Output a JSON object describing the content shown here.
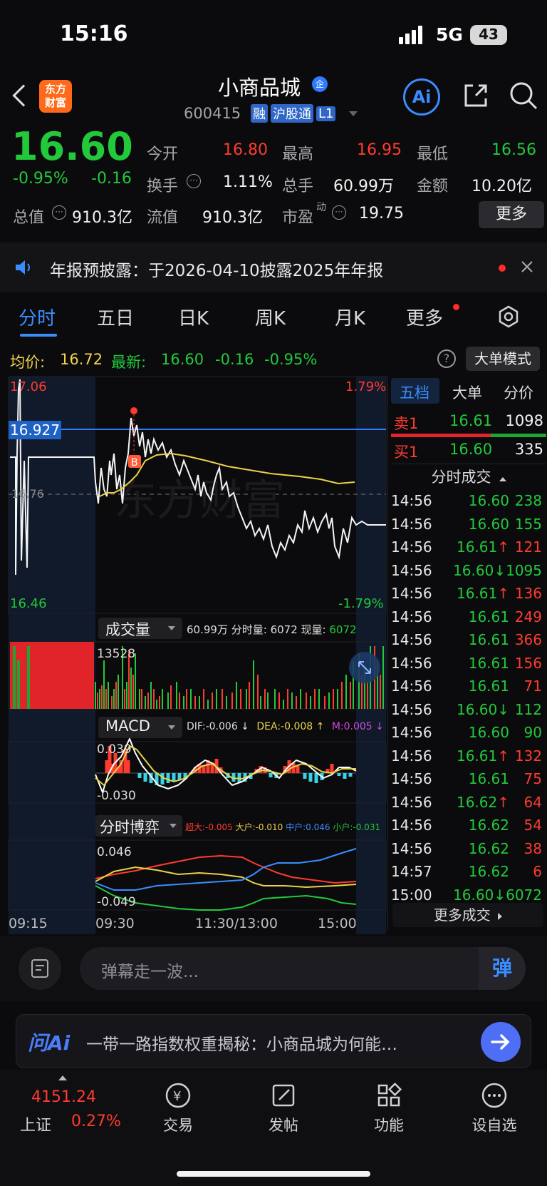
{
  "status_bar": {
    "time": "15:16",
    "network": "5G",
    "battery": "43"
  },
  "header": {
    "brand_line1": "东方",
    "brand_line2": "财富",
    "stock_name": "小商品城",
    "name_badge": "企",
    "code": "600415",
    "tags": [
      "融",
      "沪股通",
      "L1"
    ],
    "ai_label": "Ai"
  },
  "quote": {
    "price": "16.60",
    "change_pct": "-0.95%",
    "change": "-0.16",
    "fields": [
      {
        "label": "今开",
        "value": "16.80",
        "color": "#ff3b30"
      },
      {
        "label": "最高",
        "value": "16.95",
        "color": "#ff3b30"
      },
      {
        "label": "最低",
        "value": "16.56",
        "color": "#22c93a"
      },
      {
        "label": "换手",
        "value": "1.11%",
        "color": "#f2f2f2"
      },
      {
        "label": "总手",
        "value": "60.99万",
        "color": "#f2f2f2"
      },
      {
        "label": "金额",
        "value": "10.20亿",
        "color": "#f2f2f2"
      },
      {
        "label": "总值",
        "value": "910.3亿",
        "color": "#f2f2f2"
      },
      {
        "label": "流值",
        "value": "910.3亿",
        "color": "#f2f2f2"
      },
      {
        "label": "市盈",
        "value": "19.75",
        "color": "#f2f2f2"
      }
    ],
    "pe_sup": "动",
    "more_button": "更多"
  },
  "notice": {
    "text": "年报预披露：于2026-04-10披露2025年年报"
  },
  "tabs": [
    "分时",
    "五日",
    "日K",
    "周K",
    "月K",
    "更多"
  ],
  "avg_line": {
    "avg_label": "均价:",
    "avg_value": "16.72",
    "latest_label": "最新:",
    "latest_value": "16.60",
    "latest_change": "-0.16",
    "latest_pct": "-0.95%",
    "big_order_button": "大单模式"
  },
  "chart_labels": {
    "high_price": "17.06",
    "high_pct": "1.79%",
    "low_price": "16.46",
    "low_pct": "-1.79%",
    "crosshair_price": "16.927",
    "mid_price": "16.76",
    "marker": "B"
  },
  "volume_panel": {
    "selector": "成交量",
    "info_total": "60.99万",
    "info_min_label": "分时量:",
    "info_min_value": "6072",
    "info_now_label": "现量:",
    "info_now_value": "6072",
    "peak_value": "13528"
  },
  "macd_panel": {
    "selector": "MACD",
    "dif": "DIF:-0.006 ↓",
    "dea": "DEA:-0.008 ↑",
    "m": "M:0.005 ↓",
    "top": "0.039",
    "bottom": "-0.030"
  },
  "game_panel": {
    "selector": "分时博弈",
    "xl": "超大:-0.005",
    "l": "大户:-0.010",
    "m": "中户:0.046",
    "s": "小户:-0.031",
    "top": "0.046",
    "bottom": "-0.049"
  },
  "time_axis": [
    "09:15",
    "09:30",
    "11:30/13:00",
    "15:00"
  ],
  "order_book": {
    "tabs": [
      "五档",
      "大单",
      "分价"
    ],
    "sell1_label": "卖1",
    "sell1_price": "16.61",
    "sell1_vol": "1098",
    "buy1_label": "买1",
    "buy1_price": "16.60",
    "buy1_vol": "335",
    "trades_title": "分时成交",
    "more_trades": "更多成交"
  },
  "trades": [
    {
      "time": "14:56",
      "price": "16.60",
      "pc": "g",
      "arrow": "",
      "vol": "238",
      "vc": "g"
    },
    {
      "time": "14:56",
      "price": "16.60",
      "pc": "g",
      "arrow": "",
      "vol": "155",
      "vc": "g"
    },
    {
      "time": "14:56",
      "price": "16.61",
      "pc": "g",
      "arrow": "↑",
      "vol": "121",
      "vc": "r"
    },
    {
      "time": "14:56",
      "price": "16.60",
      "pc": "g",
      "arrow": "↓",
      "vol": "1095",
      "vc": "g"
    },
    {
      "time": "14:56",
      "price": "16.61",
      "pc": "g",
      "arrow": "↑",
      "vol": "136",
      "vc": "r"
    },
    {
      "time": "14:56",
      "price": "16.61",
      "pc": "g",
      "arrow": "",
      "vol": "249",
      "vc": "r"
    },
    {
      "time": "14:56",
      "price": "16.61",
      "pc": "g",
      "arrow": "",
      "vol": "366",
      "vc": "r"
    },
    {
      "time": "14:56",
      "price": "16.61",
      "pc": "g",
      "arrow": "",
      "vol": "156",
      "vc": "r"
    },
    {
      "time": "14:56",
      "price": "16.61",
      "pc": "g",
      "arrow": "",
      "vol": "71",
      "vc": "r"
    },
    {
      "time": "14:56",
      "price": "16.60",
      "pc": "g",
      "arrow": "↓",
      "vol": "112",
      "vc": "g"
    },
    {
      "time": "14:56",
      "price": "16.60",
      "pc": "g",
      "arrow": "",
      "vol": "90",
      "vc": "g"
    },
    {
      "time": "14:56",
      "price": "16.61",
      "pc": "g",
      "arrow": "↑",
      "vol": "132",
      "vc": "r"
    },
    {
      "time": "14:56",
      "price": "16.61",
      "pc": "g",
      "arrow": "",
      "vol": "75",
      "vc": "r"
    },
    {
      "time": "14:56",
      "price": "16.62",
      "pc": "g",
      "arrow": "↑",
      "vol": "64",
      "vc": "r"
    },
    {
      "time": "14:56",
      "price": "16.62",
      "pc": "g",
      "arrow": "",
      "vol": "54",
      "vc": "r"
    },
    {
      "time": "14:56",
      "price": "16.62",
      "pc": "g",
      "arrow": "",
      "vol": "38",
      "vc": "r"
    },
    {
      "time": "14:57",
      "price": "16.62",
      "pc": "g",
      "arrow": "",
      "vol": "6",
      "vc": "r"
    },
    {
      "time": "15:00",
      "price": "16.60",
      "pc": "g",
      "arrow": "↓",
      "vol": "6072",
      "vc": "g"
    }
  ],
  "comment_bar": {
    "placeholder": "弹幕走一波...",
    "danmu_button": "弹"
  },
  "ai_bar": {
    "logo": "问Ai",
    "text": "一带一路指数权重揭秘：小商品城为何能…"
  },
  "bottom_nav": {
    "index_value": "4151.24",
    "index_name": "上证",
    "index_pct": "0.27%",
    "items": [
      "交易",
      "发帖",
      "功能",
      "设自选"
    ]
  },
  "colors": {
    "up": "#ff3b30",
    "down": "#22c93a",
    "accent": "#3a8dff",
    "avg_line": "#e9d24a"
  }
}
